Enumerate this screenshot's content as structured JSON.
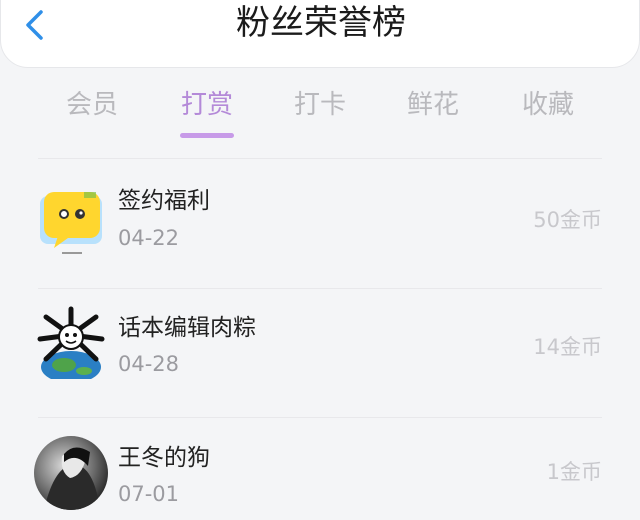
{
  "header": {
    "title": "粉丝荣誉榜",
    "back_icon": "chevron-left-icon",
    "accent": "#2f8fe8"
  },
  "tabs": [
    {
      "label": "会员",
      "active": false
    },
    {
      "label": "打赏",
      "active": true
    },
    {
      "label": "打卡",
      "active": false
    },
    {
      "label": "鲜花",
      "active": false
    },
    {
      "label": "收藏",
      "active": false
    }
  ],
  "tab_active_color": "#b48ad8",
  "rows": [
    {
      "name": "签约福利",
      "date": "04-22",
      "amount": "50金币",
      "avatar_icon": "yellow-chat-bubble-avatar"
    },
    {
      "name": "话本编辑肉粽",
      "date": "04-28",
      "amount": "14金币",
      "avatar_icon": "bug-earth-avatar"
    },
    {
      "name": "王冬的狗",
      "date": "07-01",
      "amount": "1金币",
      "avatar_icon": "photo-avatar"
    }
  ]
}
